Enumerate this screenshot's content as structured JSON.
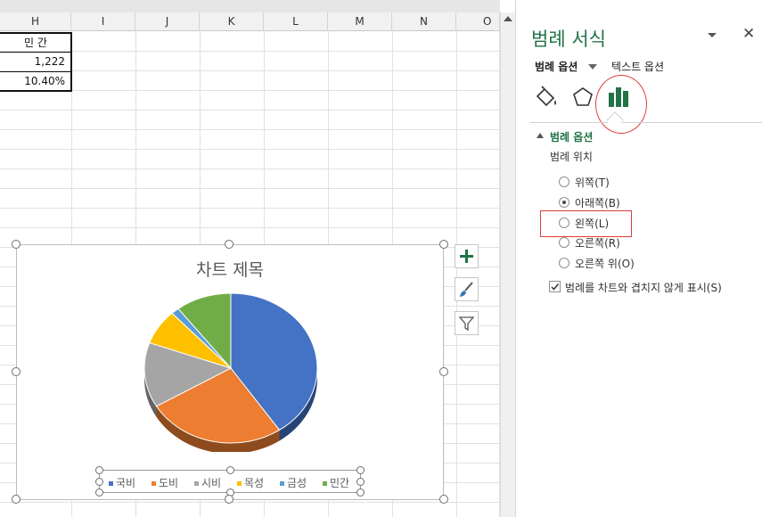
{
  "sheet": {
    "columns": [
      "H",
      "I",
      "J",
      "K",
      "L",
      "M",
      "N",
      "O"
    ],
    "table": {
      "header": "민 간",
      "value": "1,222",
      "percent": "10.40%"
    }
  },
  "chart": {
    "title": "차트 제목",
    "legend": [
      {
        "label": "국비",
        "color": "#4472C4"
      },
      {
        "label": "도비",
        "color": "#ED7D31"
      },
      {
        "label": "시비",
        "color": "#A5A5A5"
      },
      {
        "label": "목성",
        "color": "#FFC000"
      },
      {
        "label": "금성",
        "color": "#5B9BD5"
      },
      {
        "label": "민간",
        "color": "#70AD47"
      }
    ],
    "slices": [
      {
        "label": "국비",
        "percent": 40.5
      },
      {
        "label": "도비",
        "percent": 26.0
      },
      {
        "label": "시비",
        "percent": 14.0
      },
      {
        "label": "목성",
        "percent": 7.6
      },
      {
        "label": "금성",
        "percent": 1.5
      },
      {
        "label": "민간",
        "percent": 10.4
      }
    ],
    "buttons": [
      "plus-icon",
      "brush-icon",
      "filter-icon"
    ]
  },
  "pane": {
    "title": "범례 서식",
    "tabs": {
      "legend_options": "범례 옵션",
      "text_options": "텍스트 옵션"
    },
    "section_title": "범례 옵션",
    "position_label": "범례 위치",
    "positions": [
      {
        "label": "위쪽(T)",
        "selected": false
      },
      {
        "label": "아래쪽(B)",
        "selected": true
      },
      {
        "label": "왼쪽(L)",
        "selected": false
      },
      {
        "label": "오른쪽(R)",
        "selected": false
      },
      {
        "label": "오른쪽 위(O)",
        "selected": false
      }
    ],
    "overlap_checkbox": {
      "label": "범례를 차트와 겹치지 않게 표시(S)",
      "checked": true
    },
    "accent": "#217346"
  }
}
